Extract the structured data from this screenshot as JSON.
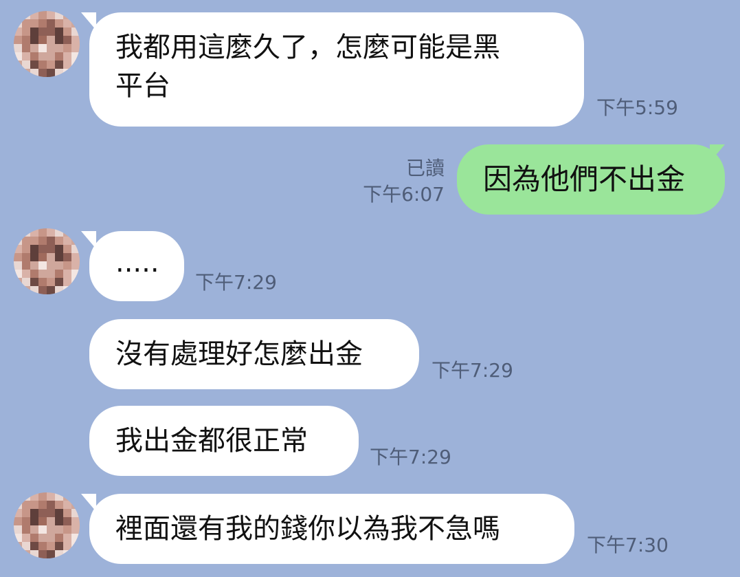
{
  "messages": [
    {
      "text": "我都用這麼久了，怎麼可能是黑\n平台",
      "time": "下午5:59"
    },
    {
      "text": "因為他們不出金",
      "read": "已讀",
      "time": "下午6:07"
    },
    {
      "text": ".....",
      "time": "下午7:29"
    },
    {
      "text": "沒有處理好怎麼出金",
      "time": "下午7:29"
    },
    {
      "text": "我出金都很正常",
      "time": "下午7:29"
    },
    {
      "text": "裡面還有我的錢你以為我不急嗎",
      "time": "下午7:30"
    }
  ],
  "colors": {
    "background": "#9DB2D9",
    "incoming_bubble": "#FFFFFF",
    "outgoing_bubble": "#9AE59A",
    "meta_text": "#4F5D78"
  },
  "icons": {
    "avatar": "avatar-pixelated"
  }
}
